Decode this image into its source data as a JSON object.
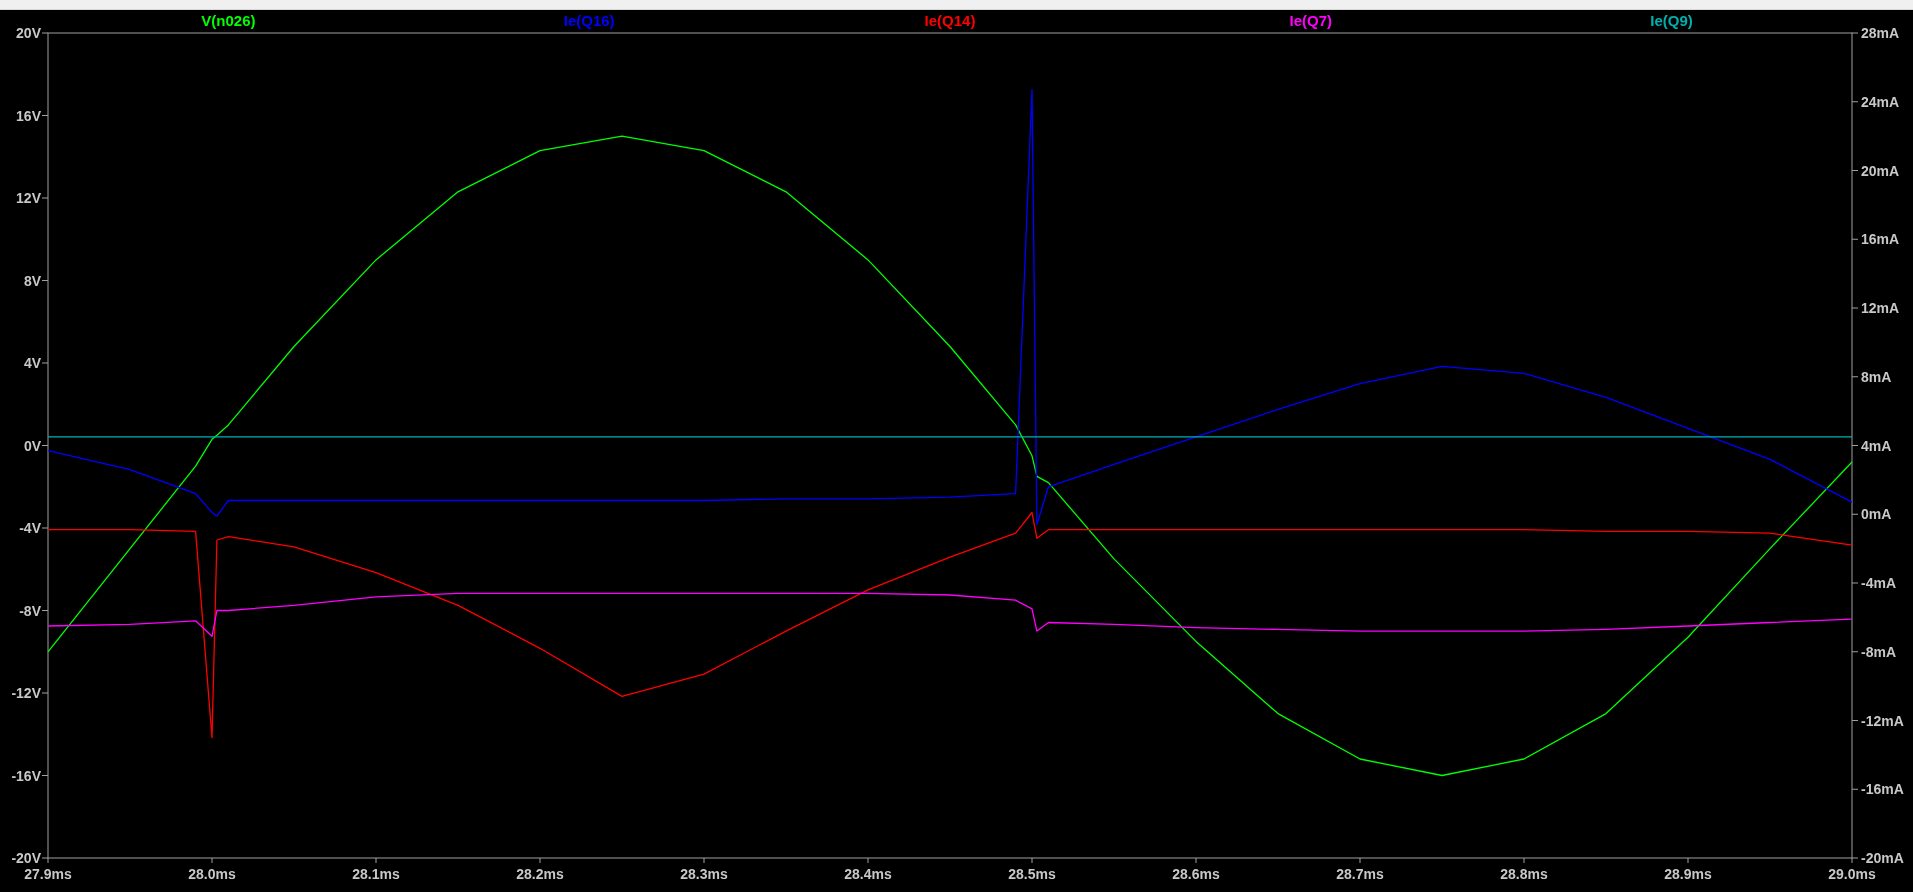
{
  "plot": {
    "chart_data": {
      "type": "line",
      "x": [
        27.9,
        27.95,
        27.99,
        28.0,
        28.003,
        28.01,
        28.05,
        28.1,
        28.15,
        28.2,
        28.25,
        28.3,
        28.35,
        28.4,
        28.45,
        28.49,
        28.5,
        28.503,
        28.51,
        28.55,
        28.6,
        28.65,
        28.7,
        28.75,
        28.8,
        28.85,
        28.9,
        28.95,
        29.0
      ],
      "xlim": [
        27.9,
        29.0
      ],
      "xticks": [
        {
          "value": 27.9,
          "label": "27.9ms"
        },
        {
          "value": 28.0,
          "label": "28.0ms"
        },
        {
          "value": 28.1,
          "label": "28.1ms"
        },
        {
          "value": 28.2,
          "label": "28.2ms"
        },
        {
          "value": 28.3,
          "label": "28.3ms"
        },
        {
          "value": 28.4,
          "label": "28.4ms"
        },
        {
          "value": 28.5,
          "label": "28.5ms"
        },
        {
          "value": 28.6,
          "label": "28.6ms"
        },
        {
          "value": 28.7,
          "label": "28.7ms"
        },
        {
          "value": 28.8,
          "label": "28.8ms"
        },
        {
          "value": 28.9,
          "label": "28.9ms"
        },
        {
          "value": 29.0,
          "label": "29.0ms"
        }
      ],
      "ylim": [
        -20,
        20
      ],
      "yticks": [
        {
          "value": 20,
          "label": "20V"
        },
        {
          "value": 16,
          "label": "16V"
        },
        {
          "value": 12,
          "label": "12V"
        },
        {
          "value": 8,
          "label": "8V"
        },
        {
          "value": 4,
          "label": "4V"
        },
        {
          "value": 0,
          "label": "0V"
        },
        {
          "value": -4,
          "label": "-4V"
        },
        {
          "value": -8,
          "label": "-8V"
        },
        {
          "value": -12,
          "label": "-12V"
        },
        {
          "value": -16,
          "label": "-16V"
        },
        {
          "value": -20,
          "label": "-20V"
        }
      ],
      "y2lim": [
        -20,
        28
      ],
      "y2ticks": [
        {
          "value": 28,
          "label": "28mA"
        },
        {
          "value": 24,
          "label": "24mA"
        },
        {
          "value": 20,
          "label": "20mA"
        },
        {
          "value": 16,
          "label": "16mA"
        },
        {
          "value": 12,
          "label": "12mA"
        },
        {
          "value": 8,
          "label": "8mA"
        },
        {
          "value": 4,
          "label": "4mA"
        },
        {
          "value": 0,
          "label": "0mA"
        },
        {
          "value": -4,
          "label": "-4mA"
        },
        {
          "value": -8,
          "label": "-8mA"
        },
        {
          "value": -12,
          "label": "-12mA"
        },
        {
          "value": -16,
          "label": "-16mA"
        },
        {
          "value": -20,
          "label": "-20mA"
        }
      ],
      "series": [
        {
          "name": "V(n026)",
          "color": "#00ff00",
          "values": [
            -10,
            -5,
            -1,
            0.3,
            0.5,
            1.0,
            4.8,
            9.0,
            12.3,
            14.3,
            15,
            14.3,
            12.3,
            9,
            4.8,
            1.0,
            -0.5,
            -1.5,
            -1.8,
            -5.5,
            -9.5,
            -13,
            -15.2,
            -16,
            -15.2,
            -13,
            -9.3,
            -5,
            -0.8
          ]
        },
        {
          "name": "Ie(Q16)",
          "color": "#0000ff",
          "axis": "y2",
          "values": [
            3.7,
            2.6,
            1.2,
            0.1,
            -0.1,
            0.8,
            0.8,
            0.8,
            0.8,
            0.8,
            0.8,
            0.8,
            0.9,
            0.9,
            1.0,
            1.2,
            24.7,
            -0.6,
            1.6,
            2.9,
            4.5,
            6.1,
            7.6,
            8.6,
            8.2,
            6.8,
            5.0,
            3.2,
            0.7
          ]
        },
        {
          "name": "Ie(Q14)",
          "color": "#ff0000",
          "axis": "y2",
          "values": [
            -0.9,
            -0.9,
            -1.0,
            -13.0,
            -1.5,
            -1.3,
            -1.9,
            -3.4,
            -5.3,
            -7.8,
            -10.6,
            -9.3,
            -6.8,
            -4.4,
            -2.5,
            -1.1,
            0.1,
            -1.4,
            -0.9,
            -0.9,
            -0.9,
            -0.9,
            -0.9,
            -0.9,
            -0.9,
            -1.0,
            -1.0,
            -1.1,
            -1.8
          ]
        },
        {
          "name": "Ie(Q7)",
          "color": "#ff00ff",
          "axis": "y2",
          "values": [
            -6.5,
            -6.4,
            -6.2,
            -7.1,
            -5.6,
            -5.6,
            -5.3,
            -4.8,
            -4.6,
            -4.6,
            -4.6,
            -4.6,
            -4.6,
            -4.6,
            -4.7,
            -5.0,
            -5.5,
            -6.8,
            -6.3,
            -6.4,
            -6.6,
            -6.7,
            -6.8,
            -6.8,
            -6.8,
            -6.7,
            -6.5,
            -6.3,
            -6.1
          ]
        },
        {
          "name": "Ie(Q9)",
          "color": "#00b0b0",
          "axis": "y2",
          "values": [
            4.5,
            4.5,
            4.5,
            4.5,
            4.5,
            4.5,
            4.5,
            4.5,
            4.5,
            4.5,
            4.5,
            4.5,
            4.5,
            4.5,
            4.5,
            4.5,
            4.5,
            4.5,
            4.5,
            4.5,
            4.5,
            4.5,
            4.5,
            4.5,
            4.5,
            4.5,
            4.5,
            4.5,
            4.5
          ]
        }
      ]
    }
  }
}
